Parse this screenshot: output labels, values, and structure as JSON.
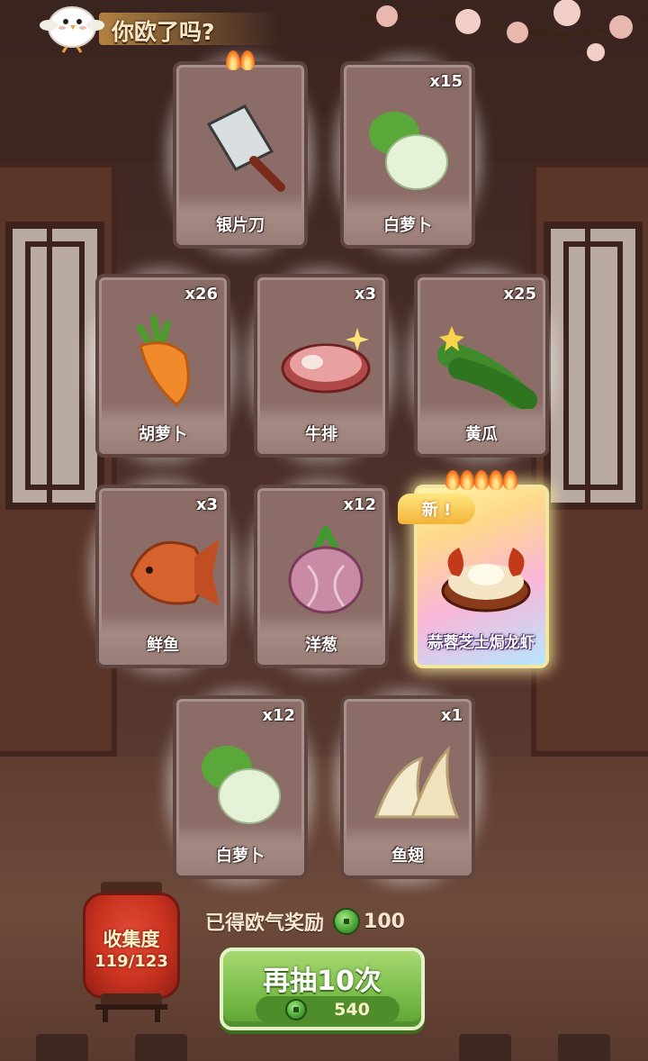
{
  "header": {
    "title": "你欧了吗?"
  },
  "cards": [
    {
      "name": "银片刀",
      "count": "",
      "icon": "cleaver-icon",
      "flames": 2
    },
    {
      "name": "白萝卜",
      "count": "x15",
      "icon": "white-radish-icon",
      "flames": 0
    },
    {
      "name": "胡萝卜",
      "count": "x26",
      "icon": "carrot-icon",
      "flames": 0
    },
    {
      "name": "牛排",
      "count": "x3",
      "icon": "steak-icon",
      "flames": 0
    },
    {
      "name": "黄瓜",
      "count": "x25",
      "icon": "cucumber-icon",
      "flames": 0
    },
    {
      "name": "鲜鱼",
      "count": "x3",
      "icon": "fish-icon",
      "flames": 0
    },
    {
      "name": "洋葱",
      "count": "x12",
      "icon": "onion-icon",
      "flames": 0
    },
    {
      "name": "蒜蓉芝士焗龙虾",
      "count": "",
      "icon": "lobster-dish-icon",
      "flames": 5,
      "badge": "新 !"
    },
    {
      "name": "白萝卜",
      "count": "x12",
      "icon": "white-radish-icon",
      "flames": 0
    },
    {
      "name": "鱼翅",
      "count": "x1",
      "icon": "shark-fin-icon",
      "flames": 0
    }
  ],
  "collection": {
    "label": "收集度",
    "value": "119/123"
  },
  "reward": {
    "label": "已得欧气奖励",
    "value": "100",
    "icon": "jade-coin-icon"
  },
  "draw_button": {
    "label": "再抽10次",
    "cost": "540",
    "icon": "jade-coin-icon"
  }
}
